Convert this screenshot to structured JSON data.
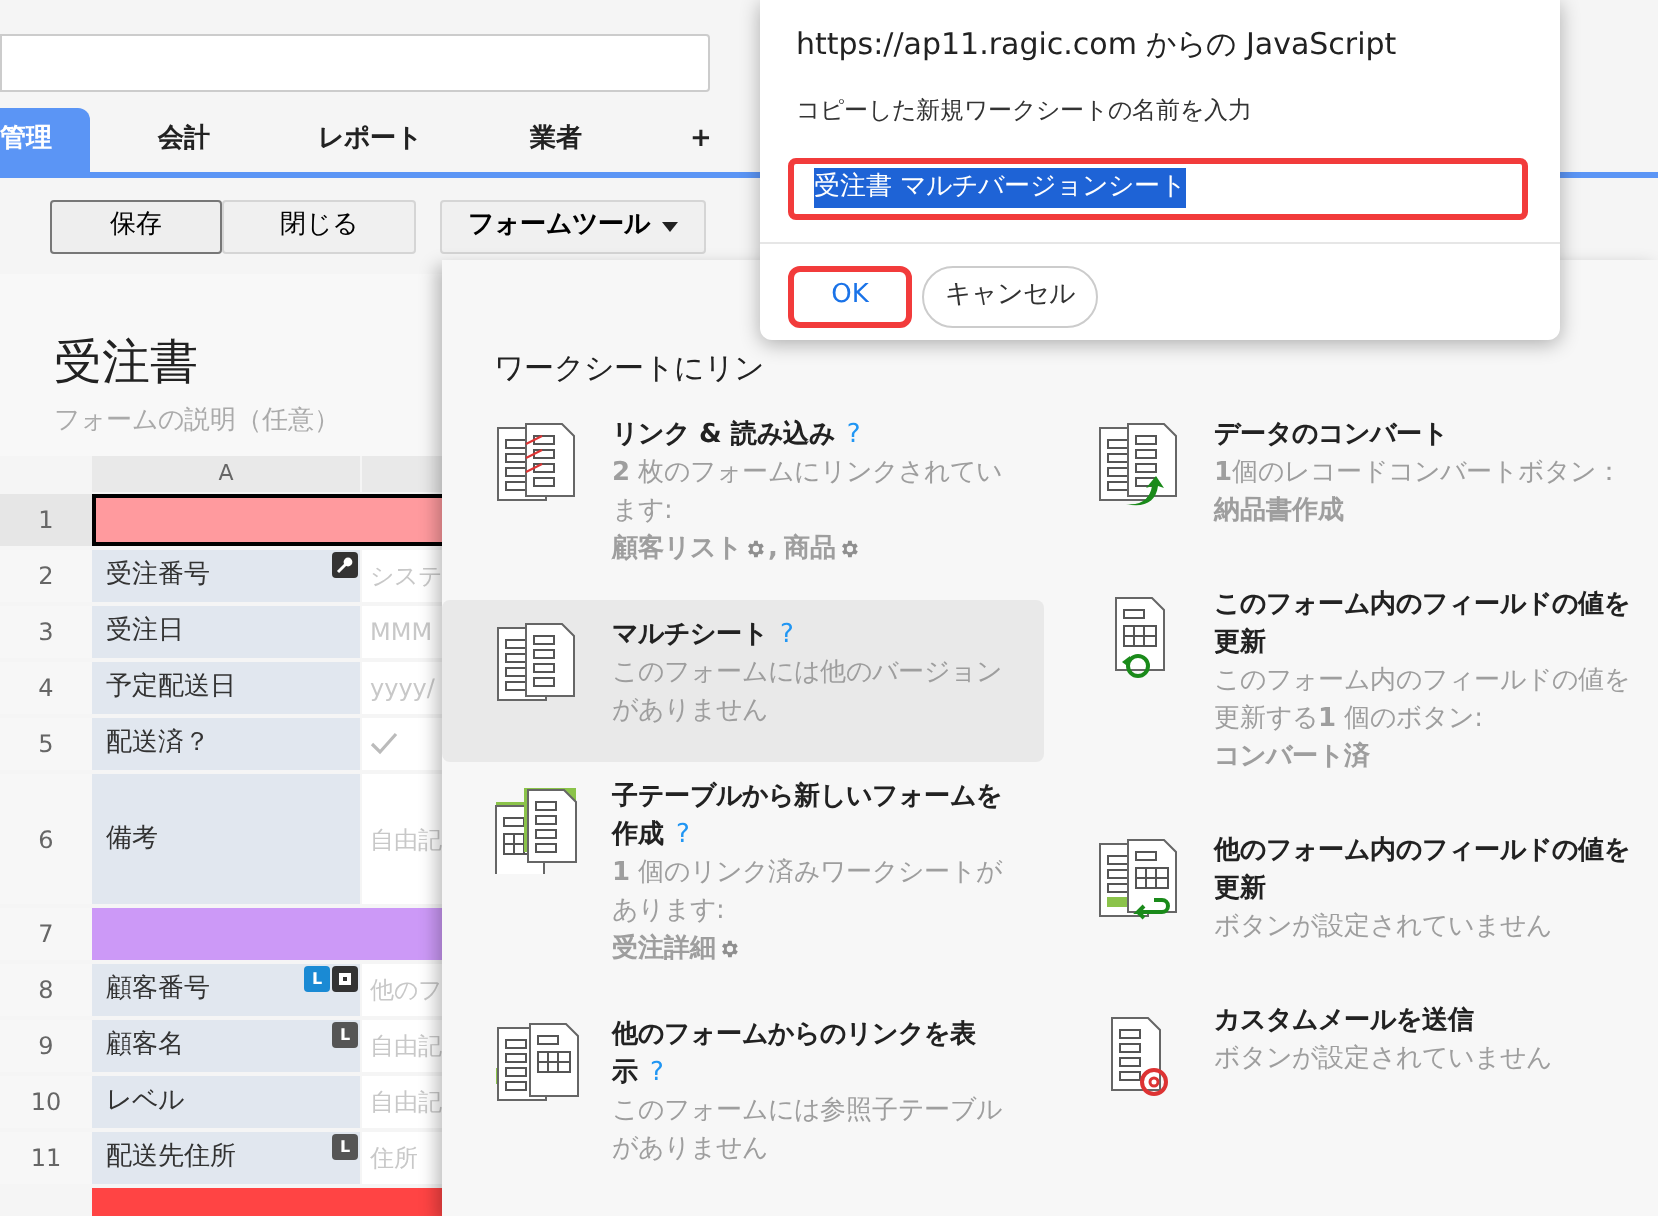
{
  "tabs": [
    {
      "label": "管理",
      "selected": true
    },
    {
      "label": "会計",
      "selected": false
    },
    {
      "label": "レポート",
      "selected": false
    },
    {
      "label": "業者",
      "selected": false
    },
    {
      "label": "+",
      "selected": false
    }
  ],
  "toolbar": [
    {
      "label": "保存",
      "kind": "plain",
      "pressed": true
    },
    {
      "label": "閉じる",
      "kind": "plain",
      "pressed": false
    },
    {
      "label": "フォームツール",
      "kind": "menu",
      "pressed": false
    }
  ],
  "form": {
    "title": "受注書",
    "description": "フォームの説明（任意）"
  },
  "sheet": {
    "column_header": "A",
    "rows": [
      {
        "number": "1",
        "kind": "band",
        "color": "#ff9a9e",
        "selected": true
      },
      {
        "number": "2",
        "kind": "field",
        "label": "受注番号",
        "badges": [
          {
            "kind": "key",
            "color": "#333333"
          }
        ],
        "value": {
          "kind": "text",
          "text": "システ"
        },
        "selected": false
      },
      {
        "number": "3",
        "kind": "field",
        "label": "受注日",
        "value": {
          "kind": "text",
          "text": "MMM"
        },
        "selected": false
      },
      {
        "number": "4",
        "kind": "field",
        "label": "予定配送日",
        "value": {
          "kind": "text",
          "text": "yyyy/"
        },
        "selected": false
      },
      {
        "number": "5",
        "kind": "field",
        "label": "配送済？",
        "value": {
          "kind": "check"
        },
        "selected": false
      },
      {
        "number": "6",
        "kind": "textarea",
        "label": "備考",
        "value": {
          "kind": "text",
          "text": "自由記"
        },
        "selected": false
      },
      {
        "number": "7",
        "kind": "band",
        "color": "#cc99f7",
        "selected": false
      },
      {
        "number": "8",
        "kind": "field",
        "label": "顧客番号",
        "badges": [
          {
            "kind": "letter",
            "text": "L",
            "color": "#1a8ad4"
          },
          {
            "kind": "link",
            "color": "#333333"
          }
        ],
        "value": {
          "kind": "text",
          "text": "他のフ"
        },
        "selected": false
      },
      {
        "number": "9",
        "kind": "field",
        "label": "顧客名",
        "badges": [
          {
            "kind": "letter",
            "text": "L",
            "color": "#555555"
          }
        ],
        "value": {
          "kind": "text",
          "text": "自由記"
        },
        "selected": false
      },
      {
        "number": "10",
        "kind": "field",
        "label": "レベル",
        "value": {
          "kind": "text",
          "text": "自由記"
        },
        "selected": false
      },
      {
        "number": "11",
        "kind": "field",
        "label": "配送先住所",
        "badges": [
          {
            "kind": "letter",
            "text": "L",
            "color": "#555555"
          }
        ],
        "value": {
          "kind": "text",
          "text": "住所"
        },
        "selected": false
      },
      {
        "kind": "band",
        "color": "#ff4444",
        "selected": false
      }
    ]
  },
  "form_tools_menu": {
    "columns": [
      {
        "heading": "ワークシートにリン",
        "items": [
          {
            "kind": "link",
            "title": "リンク & 読み込み",
            "help": "?",
            "description": "**2** 枚のフォームにリンクされています:",
            "links": [
              {
                "label": "顧客リスト",
                "after": ","
              },
              {
                "label": "商品"
              }
            ],
            "selected": false
          },
          {
            "kind": "multi",
            "title": "マルチシート",
            "help": "?",
            "description": "このフォームには他のバージョンがありません",
            "selected": true
          },
          {
            "kind": "child",
            "title": "子テーブルから新しいフォームを作成",
            "help": "?",
            "description": "**1** 個のリンク済みワークシートがあります:",
            "links": [
              {
                "label": "受注詳細"
              }
            ],
            "selected": false
          },
          {
            "kind": "backlink",
            "title": "他のフォームからのリンクを表示",
            "help": "?",
            "description": "このフォームには参照子テーブルがありません",
            "selected": false
          }
        ]
      },
      {
        "items": [
          {
            "kind": "convert",
            "title": "データのコンバート",
            "description": "**1**個のレコードコンバートボタン：",
            "links": [
              {
                "label": "納品書作成",
                "gear": false
              }
            ],
            "selected": false
          },
          {
            "kind": "update",
            "title": "このフォーム内のフィールドの値を更新",
            "description": "このフォーム内のフィールドの値を更新する**1** 個のボタン:",
            "links": [
              {
                "label": "コンバート済",
                "gear": false
              }
            ],
            "selected": false
          },
          {
            "kind": "update_other",
            "title": "他のフォーム内のフィールドの値を更新",
            "description": "ボタンが設定されていません",
            "selected": false
          },
          {
            "kind": "mail",
            "title": "カスタムメールを送信",
            "description": "ボタンが設定されていません",
            "selected": false
          }
        ]
      }
    ]
  },
  "dialog": {
    "title": "https://ap11.ragic.com からの JavaScript",
    "message": "コピーした新規ワークシートの名前を入力",
    "input": {
      "value": "受注書 マルチバージョンシート",
      "text_selected": true,
      "highlighted": true
    },
    "buttons": [
      {
        "label": "OK",
        "kind": "primary",
        "highlighted": true
      },
      {
        "label": "キャンセル",
        "kind": "secondary",
        "highlighted": false
      }
    ]
  }
}
